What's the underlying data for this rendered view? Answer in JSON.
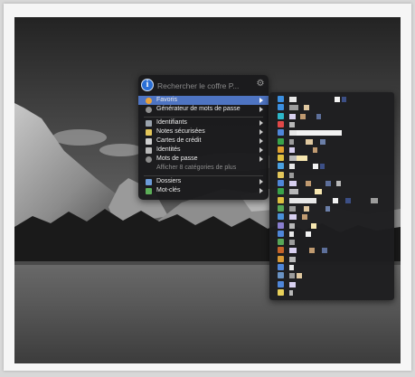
{
  "search": {
    "placeholder": "Rechercher le coffre P..."
  },
  "icons": {
    "logo": "1password-logo",
    "settings": "gear-icon"
  },
  "menu": {
    "items": [
      {
        "label": "Favoris",
        "icon": "star-icon",
        "color": "#e8a23a",
        "active": true
      },
      {
        "label": "Générateur de mots de passe",
        "icon": "generator-icon",
        "color": "#8e8e8e"
      },
      {
        "label": "Identifiants",
        "icon": "login-icon",
        "color": "#9aa3ad"
      },
      {
        "label": "Notes sécurisées",
        "icon": "secure-note-icon",
        "color": "#e3c65a"
      },
      {
        "label": "Cartes de crédit",
        "icon": "credit-card-icon",
        "color": "#cfcfcf"
      },
      {
        "label": "Identités",
        "icon": "identity-icon",
        "color": "#b9b9b9"
      },
      {
        "label": "Mots de passe",
        "icon": "password-icon",
        "color": "#8a8a8a"
      },
      {
        "label": "Afficher 8 catégories de plus"
      },
      {
        "label": "Dossiers",
        "icon": "folder-icon",
        "color": "#6c9bd8"
      },
      {
        "label": "Mot-clés",
        "icon": "tag-icon",
        "color": "#5cae58"
      }
    ]
  },
  "favorites": {
    "icon_colors": [
      "#3b8fe0",
      "#3b8fe0",
      "#2db7c9",
      "#e04848",
      "#4f86d9",
      "#3aa34a",
      "#e0a030",
      "#e0c040",
      "#4aa0e0",
      "#e3c65a",
      "#4f86d9",
      "#3aa34a",
      "#e0c040",
      "#58a658",
      "#4a90d9",
      "#8a7fd0",
      "#4f86d9",
      "#58a658",
      "#c6642a",
      "#d99a36",
      "#4f86d9",
      "#6a93c4",
      "#4f86d9",
      "#e8d05a"
    ]
  }
}
